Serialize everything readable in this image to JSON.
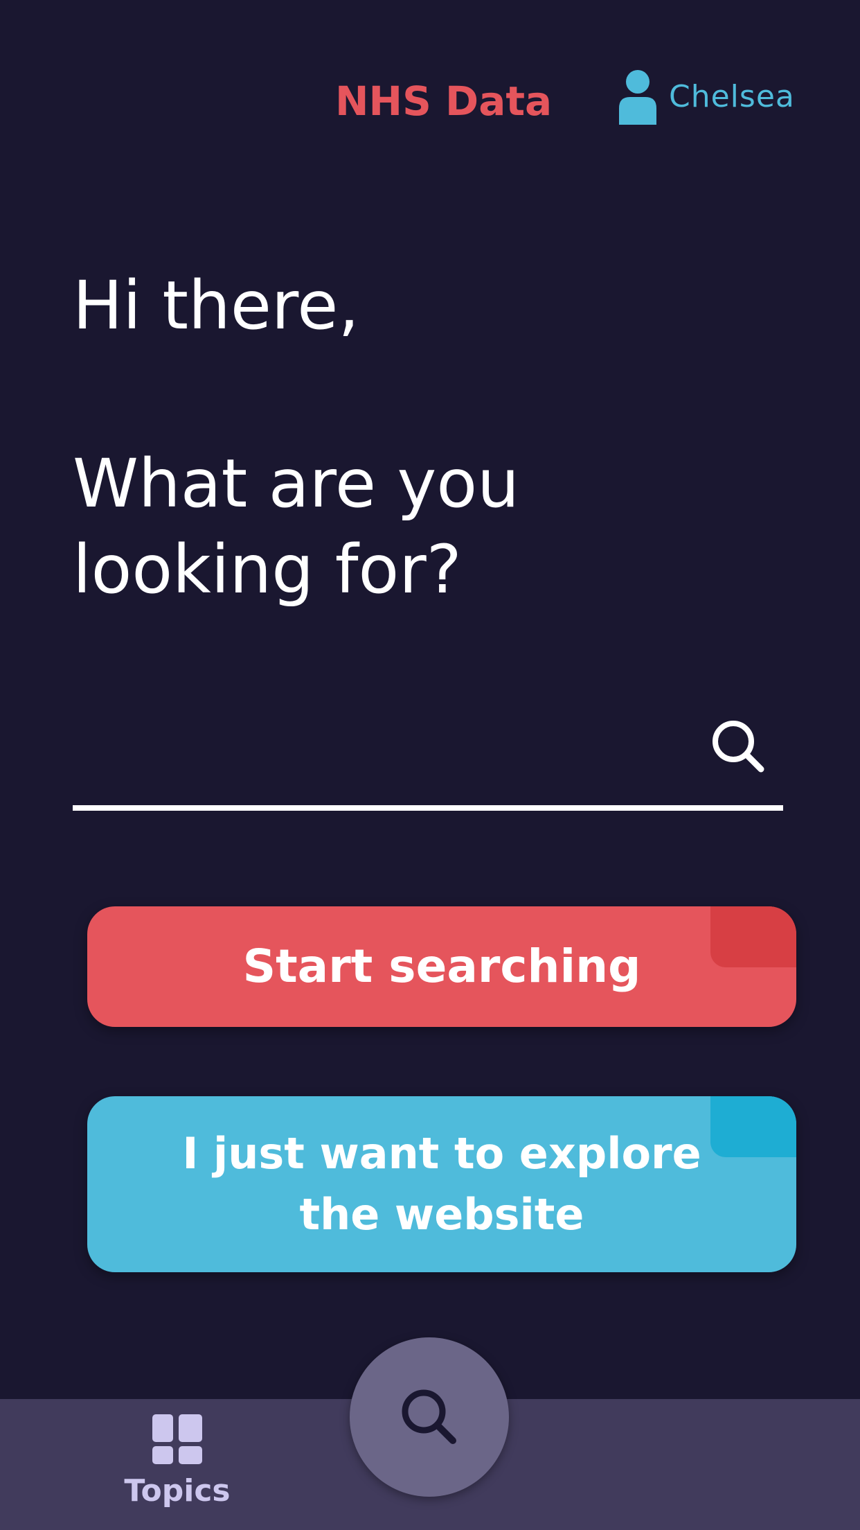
{
  "header": {
    "brand": "NHS Data",
    "user_name": "Chelsea",
    "user_icon": "user-icon"
  },
  "main": {
    "greeting": "Hi there,",
    "question": "What are you looking for?",
    "search": {
      "placeholder": "",
      "value": "",
      "icon": "search-icon"
    },
    "buttons": {
      "start_searching": "Start searching",
      "explore": "I just want to explore the website"
    }
  },
  "bottom_nav": {
    "topics_label": "Topics",
    "topics_icon": "grid-icon",
    "fab_icon": "search-icon"
  },
  "colors": {
    "background": "#1a1730",
    "brand_red": "#e5555c",
    "accent_blue": "#4fbbdb",
    "nav_bar": "#413b5c",
    "fab": "#6b6688",
    "nav_label": "#cdc7ee"
  }
}
